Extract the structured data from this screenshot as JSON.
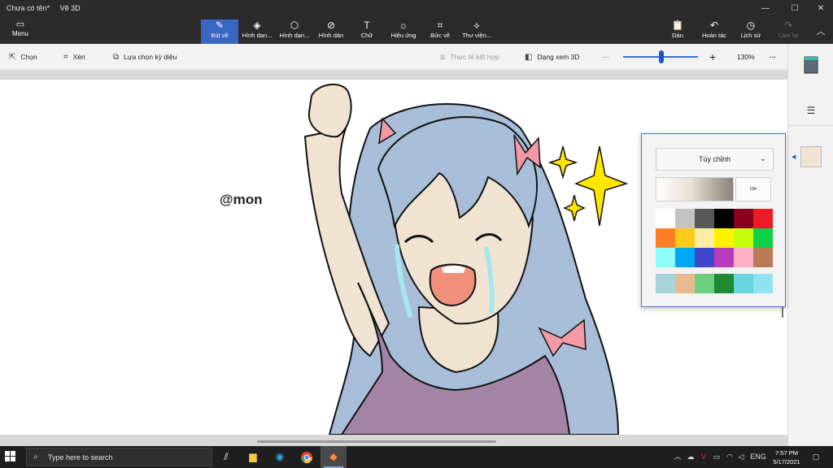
{
  "window": {
    "doc_title": "Chưa có tên*",
    "app_title": "Vẽ 3D",
    "minimize": "—",
    "maximize": "☐",
    "close": "✕"
  },
  "menu": {
    "label": "Menu"
  },
  "tools": [
    {
      "label": "Bút vẽ",
      "icon": "brush-icon",
      "glyph": "✎"
    },
    {
      "label": "Hình dạn...",
      "icon": "2d-shapes-icon",
      "glyph": "◈"
    },
    {
      "label": "Hình dạn...",
      "icon": "3d-shapes-icon",
      "glyph": "⬡"
    },
    {
      "label": "Hình dán",
      "icon": "stickers-icon",
      "glyph": "⊘"
    },
    {
      "label": "Chữ",
      "icon": "text-icon",
      "glyph": "T"
    },
    {
      "label": "Hiệu ứng",
      "icon": "effects-icon",
      "glyph": "☼"
    },
    {
      "label": "Bức vẽ",
      "icon": "canvas-icon",
      "glyph": "⌗"
    },
    {
      "label": "Thư viện...",
      "icon": "3d-library-icon",
      "glyph": "⟡"
    }
  ],
  "right_tools": [
    {
      "label": "Dán",
      "glyph": "📋"
    },
    {
      "label": "Hoàn tác",
      "glyph": "↶"
    },
    {
      "label": "Lịch sử",
      "glyph": "◷"
    },
    {
      "label": "Làm lại",
      "glyph": "↷"
    }
  ],
  "toolbar": {
    "select": "Chọn",
    "crop": "Xén",
    "magic_select": "Lựa chọn kỳ diệu",
    "mixed_reality": "Thực tế kết hợp",
    "view_3d": "Dạng xem 3D",
    "minus": "—",
    "plus": "+",
    "zoom": "130%",
    "more": "···"
  },
  "canvas": {
    "watermark": "@mon"
  },
  "color_popup": {
    "mode": "Tùy chỉnh",
    "palette": [
      "#ffffff",
      "#c3c3c3",
      "#585858",
      "#000000",
      "#88001b",
      "#ec1c24",
      "#ff7f27",
      "#ffca18",
      "#fdeca6",
      "#fff200",
      "#c4ff0e",
      "#0ed145",
      "#8cfffb",
      "#00a8f3",
      "#3f48cc",
      "#b83dba",
      "#ffaec8",
      "#b97a56"
    ],
    "recent": [
      "#a8d3dc",
      "#e8b88f",
      "#6ccf7e",
      "#1f8a32",
      "#66d5e0",
      "#8fe3f0"
    ]
  },
  "sidebar": {
    "selected_color": "#f1e3d1"
  },
  "taskbar": {
    "search_placeholder": "Type here to search",
    "language": "ENG",
    "time": "7:57 PM",
    "date": "5/17/2021"
  }
}
